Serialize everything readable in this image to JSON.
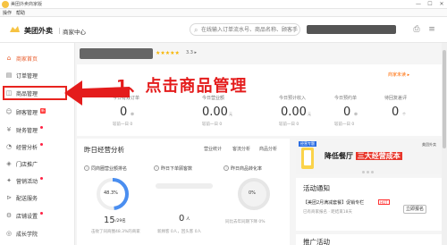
{
  "window": {
    "title": "美团外卖商家版",
    "controls": [
      "—",
      "☐",
      "✕"
    ]
  },
  "menubar": {
    "items": [
      "操作",
      "帮助"
    ]
  },
  "header": {
    "brand": "美团外卖",
    "subtitle": "商家中心",
    "search_placeholder": "在线输入订单流水号、商品名称、顾客手机号"
  },
  "sidebar": {
    "items": [
      {
        "label": "商家首页",
        "icon": "home-icon",
        "active": true
      },
      {
        "label": "订单管理",
        "icon": "order-icon"
      },
      {
        "label": "商品管理",
        "icon": "goods-icon"
      },
      {
        "label": "顾客管理",
        "icon": "customer-icon",
        "badge": "新"
      },
      {
        "label": "财务管理",
        "icon": "finance-icon"
      },
      {
        "label": "经营分析",
        "icon": "analysis-icon"
      },
      {
        "label": "门店推广",
        "icon": "promote-icon"
      },
      {
        "label": "营销活动",
        "icon": "marketing-icon"
      },
      {
        "label": "配送服务",
        "icon": "delivery-icon"
      },
      {
        "label": "店铺设置",
        "icon": "settings-icon"
      },
      {
        "label": "成长学院",
        "icon": "academy-icon"
      }
    ]
  },
  "store": {
    "stars": "★★★★★",
    "score": "3.3 ▸"
  },
  "stats": {
    "store_link": "商家未读 ▸",
    "items": [
      {
        "label": "今日有效订单",
        "value": "0",
        "unit": "单",
        "compare": "较前一日 0"
      },
      {
        "label": "今日营业额",
        "value": "0.00",
        "unit": "元",
        "compare": "较前一日 0"
      },
      {
        "label": "今日预计收入",
        "value": "0.00",
        "unit": "元",
        "compare": "较前一日 0"
      },
      {
        "label": "今日预约单",
        "value": "0",
        "unit": "单",
        "compare": "较前一日 0"
      },
      {
        "label": "待回复差评",
        "value": "0",
        "unit": "个",
        "compare": ""
      }
    ]
  },
  "annotation": {
    "text": "1、点击商品管理"
  },
  "yesterday": {
    "title": "昨日经营分析",
    "tabs": [
      "营业统计",
      "客流分析",
      "商品分析"
    ],
    "card1": {
      "title": "同商圈营业额排名",
      "pct": "48.3%",
      "rank": "15",
      "rank_total": "/29名",
      "caption": "击败了同商圈48.3%的商家"
    },
    "card2": {
      "title": "昨日下单顾客数",
      "count": "0",
      "unit": "人",
      "caption": "新顾客 0人，回头客 0人"
    },
    "card3": {
      "title": "昨日商品转化率",
      "pct": "0%",
      "caption": "同比去年同期下降 0%"
    }
  },
  "banner": {
    "tag": "经营专题",
    "headline_prefix": "降低餐厅",
    "headline_highlight": "三大经营成本",
    "brand_mini": "美团外卖"
  },
  "activity": {
    "title": "活动通知",
    "item_title": "【美团2月满减套餐】促销专栏",
    "hot": "HOT",
    "item_sub": "已有商家报名 · 距结束18天",
    "enroll_label": "立即报名"
  },
  "promo": {
    "title": "推广活动"
  },
  "colors": {
    "accent": "#e85b2a",
    "annotation": "#e41c1c",
    "brand_yellow": "#f6c343"
  }
}
